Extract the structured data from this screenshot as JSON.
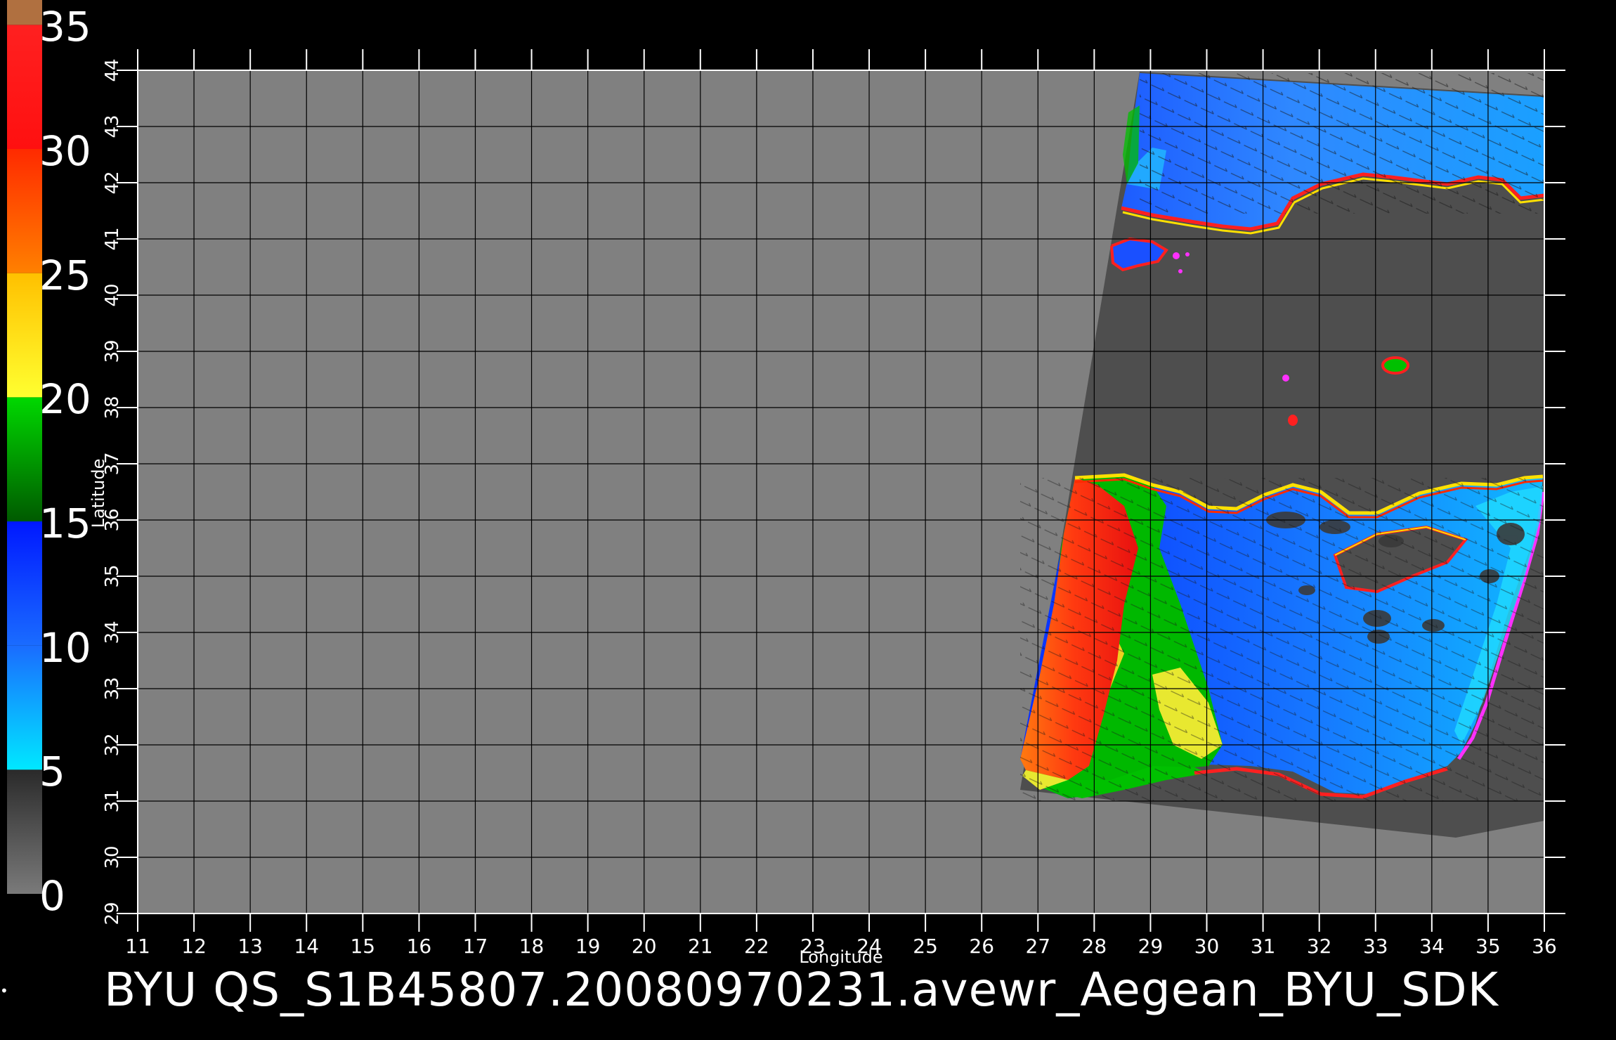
{
  "title": "BYU  QS_S1B45807.20080970231.avewr_Aegean_BYU_SDK",
  "x_axis": {
    "label": "Longitude",
    "range": [
      11,
      36
    ],
    "ticks": [
      "11",
      "12",
      "13",
      "14",
      "15",
      "16",
      "17",
      "18",
      "19",
      "20",
      "21",
      "22",
      "23",
      "24",
      "25",
      "26",
      "27",
      "28",
      "29",
      "30",
      "31",
      "32",
      "33",
      "34",
      "35",
      "36"
    ]
  },
  "y_axis": {
    "label": "Latitude",
    "range": [
      29,
      44
    ],
    "ticks": [
      "29",
      "30",
      "31",
      "32",
      "33",
      "34",
      "35",
      "36",
      "37",
      "38",
      "39",
      "40",
      "41",
      "42",
      "43",
      "44"
    ]
  },
  "colorbar": {
    "labels": [
      "35",
      "30",
      "25",
      "20",
      "15",
      "10",
      "5",
      "0"
    ],
    "stops": [
      {
        "from": 0,
        "to": 5,
        "colors": [
          "#7a7a7a",
          "#2a2a2a"
        ]
      },
      {
        "from": 5,
        "to": 10,
        "colors": [
          "#00e8ff",
          "#1a6cff"
        ]
      },
      {
        "from": 10,
        "to": 15,
        "colors": [
          "#1a6cff",
          "#0018ff"
        ]
      },
      {
        "from": 15,
        "to": 20,
        "colors": [
          "#005a00",
          "#00d800"
        ]
      },
      {
        "from": 20,
        "to": 25,
        "colors": [
          "#ffff30",
          "#ffc000"
        ]
      },
      {
        "from": 25,
        "to": 30,
        "colors": [
          "#ff8000",
          "#ff2a00"
        ]
      },
      {
        "from": 30,
        "to": 35,
        "colors": [
          "#ff1010",
          "#ff2020"
        ]
      },
      {
        "from": 35,
        "to": 36,
        "colors": [
          "#b07040",
          "#b07040"
        ]
      }
    ]
  },
  "colors": {
    "background": "#000000",
    "plot_area": "#808080",
    "land_swath": "#4e4e4e",
    "gridline": "#000000",
    "frame": "#ffffff"
  }
}
